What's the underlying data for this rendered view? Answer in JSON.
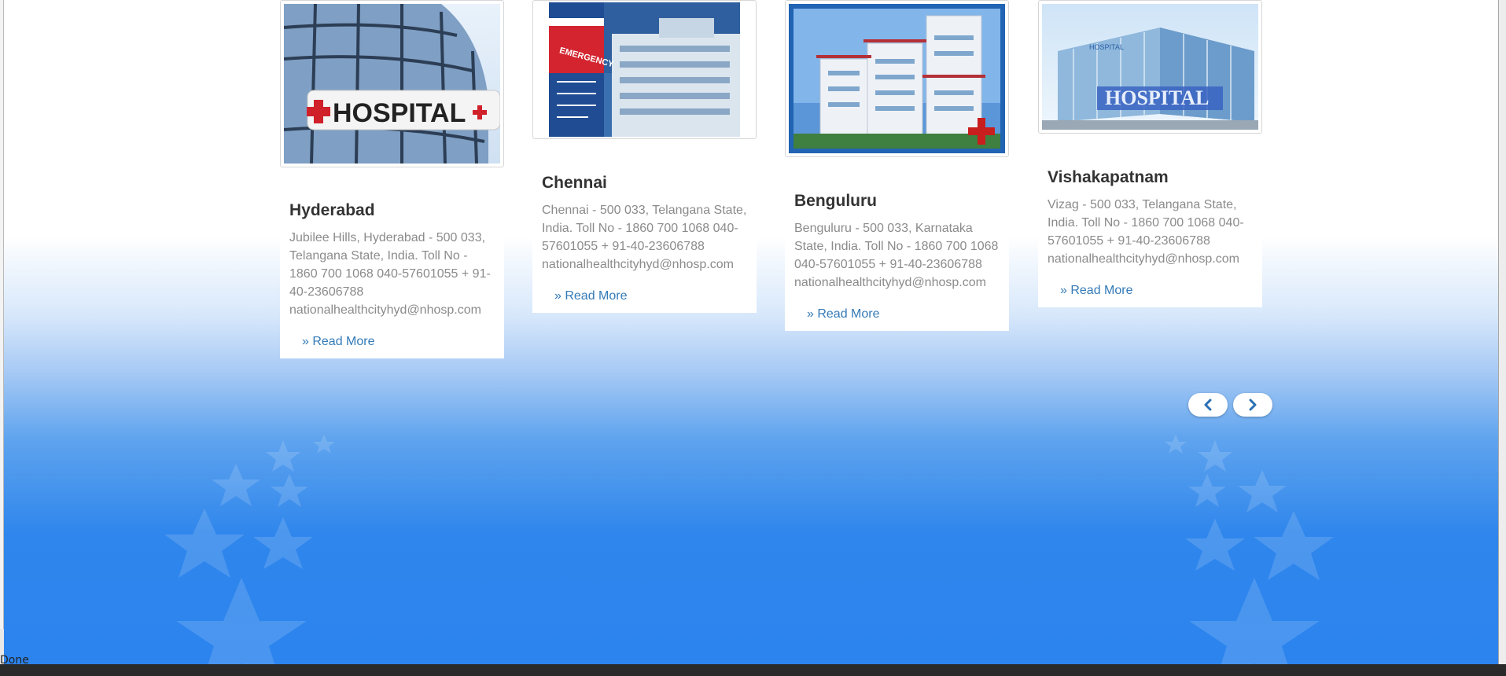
{
  "hospitals": [
    {
      "city": "Hyderabad",
      "address": "Jubilee Hills, Hyderabad - 500 033, Telangana State, India. Toll No - 1860 700 1068 040-57601055 + 91-40-23606788 nationalhealthcityhyd@nhosp.com",
      "read_more": "» Read More",
      "image_caption": "HOSPITAL"
    },
    {
      "city": "Chennai",
      "address": "Chennai - 500 033, Telangana State, India. Toll No - 1860 700 1068 040-57601055 + 91-40-23606788 nationalhealthcityhyd@nhosp.com",
      "read_more": "» Read More",
      "image_caption": "EMERGENCY"
    },
    {
      "city": "Benguluru",
      "address": "Benguluru - 500 033, Karnataka State, India. Toll No - 1860 700 1068 040-57601055 + 91-40-23606788 nationalhealthcityhyd@nhosp.com",
      "read_more": "» Read More",
      "image_caption": ""
    },
    {
      "city": "Vishakapatnam",
      "address": "Vizag - 500 033, Telangana State, India. Toll No - 1860 700 1068 040-57601055 + 91-40-23606788 nationalhealthcityhyd@nhosp.com",
      "read_more": "» Read More",
      "image_caption": "HOSPITAL"
    }
  ],
  "carousel": {
    "prev_icon": "chevron-left-icon",
    "next_icon": "chevron-right-icon"
  },
  "status_bar": {
    "text": "Done"
  },
  "colors": {
    "link": "#337ab7",
    "title": "#333333",
    "body_text": "#8b8b8b",
    "background_blue": "#2c84ee"
  }
}
